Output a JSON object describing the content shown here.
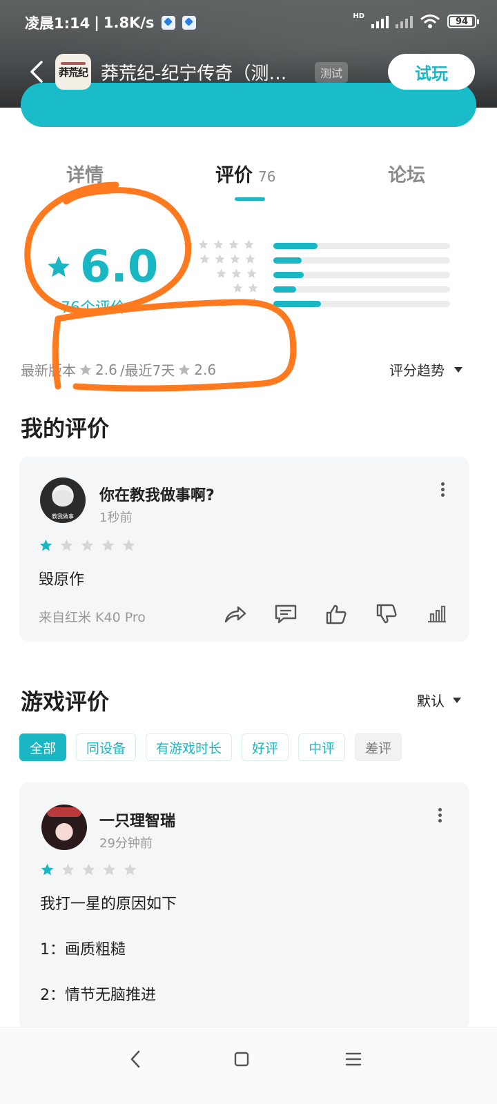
{
  "status_bar": {
    "time": "凌晨1:14",
    "speed": "1.8K/s",
    "hd": "HD",
    "battery": "94"
  },
  "app_header": {
    "title": "莽荒纪-纪宁传奇（测…",
    "tag": "测试",
    "icon_text": "莽荒纪",
    "try_button": "试玩"
  },
  "tabs": [
    {
      "label": "详情"
    },
    {
      "label": "评价",
      "count": "76"
    },
    {
      "label": "论坛"
    }
  ],
  "rating": {
    "score": "6.0",
    "count_label": "76个评价",
    "distribution": [
      {
        "stars": 5,
        "fraction": 0.25
      },
      {
        "stars": 4,
        "fraction": 0.16
      },
      {
        "stars": 3,
        "fraction": 0.17
      },
      {
        "stars": 2,
        "fraction": 0.13
      },
      {
        "stars": 1,
        "fraction": 0.27
      }
    ],
    "recent_label": "最新版本",
    "recent_score": "2.6",
    "week_label": "/最近7天",
    "week_score": "2.6",
    "trend_label": "评分趋势"
  },
  "my_review": {
    "section_title": "我的评价",
    "user": "你在教我做事啊?",
    "avatar_caption": "教我做事",
    "time": "1秒前",
    "stars": 1,
    "text": "毁原作",
    "device": "来自红米 K40 Pro"
  },
  "game_reviews": {
    "section_title": "游戏评价",
    "sort_label": "默认",
    "filters": [
      "全部",
      "同设备",
      "有游戏时长",
      "好评",
      "中评",
      "差评"
    ],
    "items": [
      {
        "user": "一只理智瑞",
        "time": "29分钟前",
        "stars": 1,
        "lines": [
          "我打一星的原因如下",
          "1：画质粗糙",
          "2：情节无脑推进"
        ]
      }
    ]
  },
  "colors": {
    "accent": "#18b7c3",
    "annotation": "#ff7a1f",
    "star_empty": "#d6d6d6"
  },
  "icons": [
    "back-icon",
    "star-icon",
    "share-icon",
    "comment-icon",
    "thumbs-up-icon",
    "thumbs-down-icon",
    "chart-icon",
    "more-icon",
    "home-square-icon",
    "menu-icon"
  ]
}
